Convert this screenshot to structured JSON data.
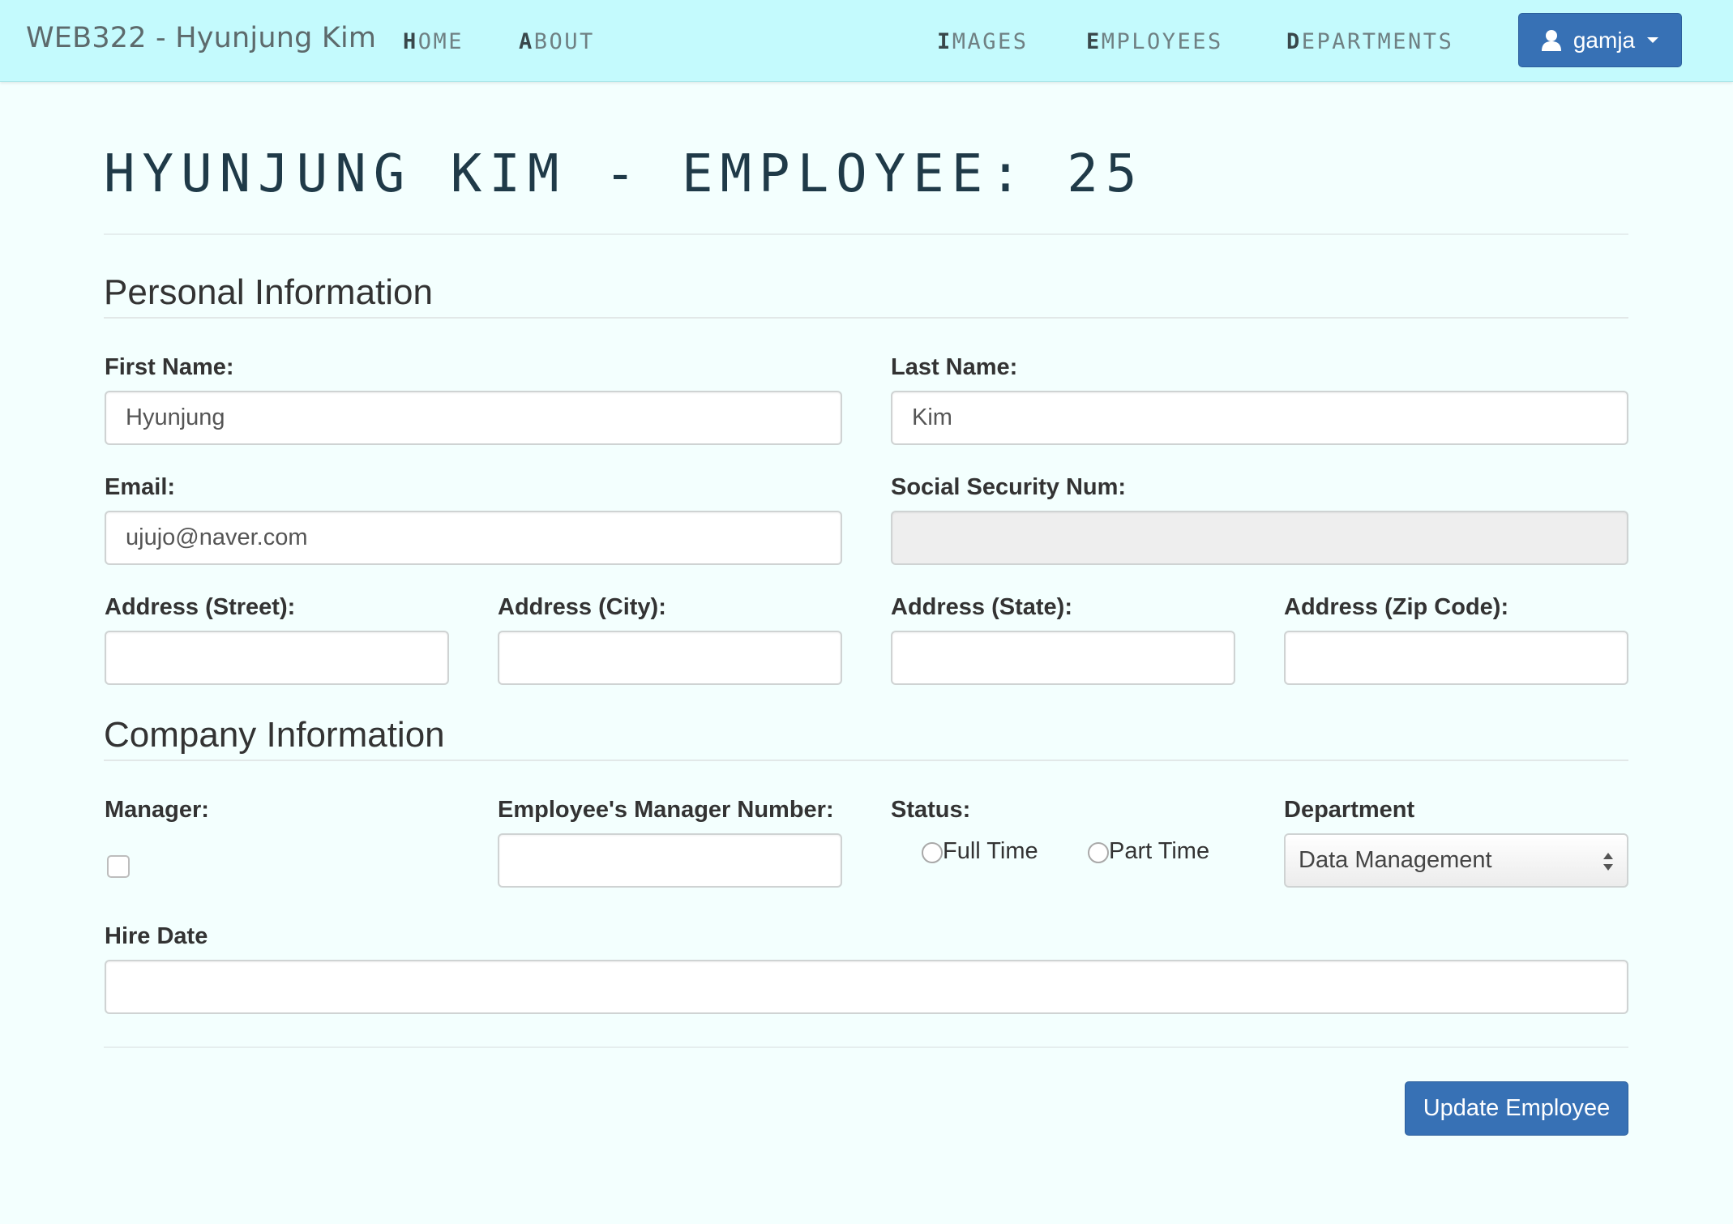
{
  "navbar": {
    "brand": "WEB322 - Hyunjung Kim",
    "links_left": [
      {
        "first": "H",
        "rest": "OME"
      },
      {
        "first": "A",
        "rest": "BOUT"
      }
    ],
    "links_right": [
      {
        "first": "I",
        "rest": "MAGES"
      },
      {
        "first": "E",
        "rest": "MPLOYEES"
      },
      {
        "first": "D",
        "rest": "EPARTMENTS"
      }
    ],
    "user": {
      "name": "gamja",
      "icon": "user-icon",
      "caret_icon": "caret-down-icon"
    }
  },
  "page": {
    "title": "HYUNJUNG KIM - EMPLOYEE: 25"
  },
  "personal": {
    "title": "Personal Information",
    "first_name": {
      "label": "First Name:",
      "value": "Hyunjung"
    },
    "last_name": {
      "label": "Last Name:",
      "value": "Kim"
    },
    "email": {
      "label": "Email:",
      "value": "ujujo@naver.com"
    },
    "ssn": {
      "label": "Social Security Num:",
      "value": ""
    },
    "street": {
      "label": "Address (Street):",
      "value": ""
    },
    "city": {
      "label": "Address (City):",
      "value": ""
    },
    "state": {
      "label": "Address (State):",
      "value": ""
    },
    "zip": {
      "label": "Address (Zip Code):",
      "value": ""
    }
  },
  "company": {
    "title": "Company Information",
    "manager": {
      "label": "Manager:",
      "checked": false
    },
    "manager_number": {
      "label": "Employee's Manager Number:",
      "value": ""
    },
    "status": {
      "label": "Status:",
      "options": [
        "Full Time",
        "Part Time"
      ],
      "selected": null
    },
    "department": {
      "label": "Department",
      "selected": "Data Management"
    },
    "hire_date": {
      "label": "Hire Date",
      "value": ""
    }
  },
  "actions": {
    "update_label": "Update Employee"
  },
  "colors": {
    "navbar_bg": "#c4fafd",
    "page_bg": "#f3fffe",
    "primary": "#3771b5",
    "title_text": "#1f3a48"
  }
}
